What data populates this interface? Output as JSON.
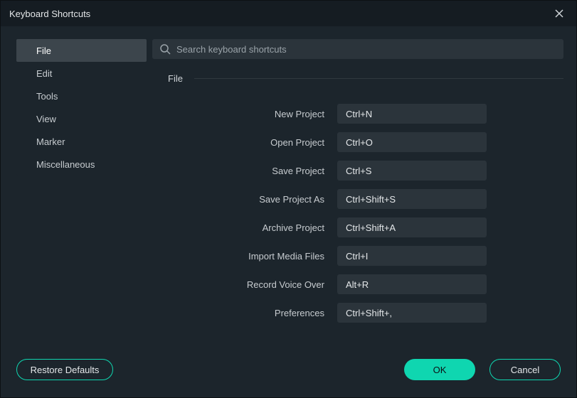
{
  "colors": {
    "accent": "#0fd6b0",
    "bg": "#1c252c",
    "input_bg": "#2b343b",
    "selected_bg": "#3c454c"
  },
  "title": "Keyboard Shortcuts",
  "search": {
    "placeholder": "Search keyboard shortcuts",
    "value": ""
  },
  "sidebar": {
    "items": [
      {
        "label": "File",
        "selected": true
      },
      {
        "label": "Edit",
        "selected": false
      },
      {
        "label": "Tools",
        "selected": false
      },
      {
        "label": "View",
        "selected": false
      },
      {
        "label": "Marker",
        "selected": false
      },
      {
        "label": "Miscellaneous",
        "selected": false
      }
    ]
  },
  "section": {
    "header": "File",
    "rows": [
      {
        "label": "New Project",
        "value": "Ctrl+N"
      },
      {
        "label": "Open Project",
        "value": "Ctrl+O"
      },
      {
        "label": "Save Project",
        "value": "Ctrl+S"
      },
      {
        "label": "Save Project As",
        "value": "Ctrl+Shift+S"
      },
      {
        "label": "Archive Project",
        "value": "Ctrl+Shift+A"
      },
      {
        "label": "Import Media Files",
        "value": "Ctrl+I"
      },
      {
        "label": "Record Voice Over",
        "value": "Alt+R"
      },
      {
        "label": "Preferences",
        "value": "Ctrl+Shift+,"
      }
    ]
  },
  "buttons": {
    "restore": "Restore Defaults",
    "ok": "OK",
    "cancel": "Cancel"
  }
}
